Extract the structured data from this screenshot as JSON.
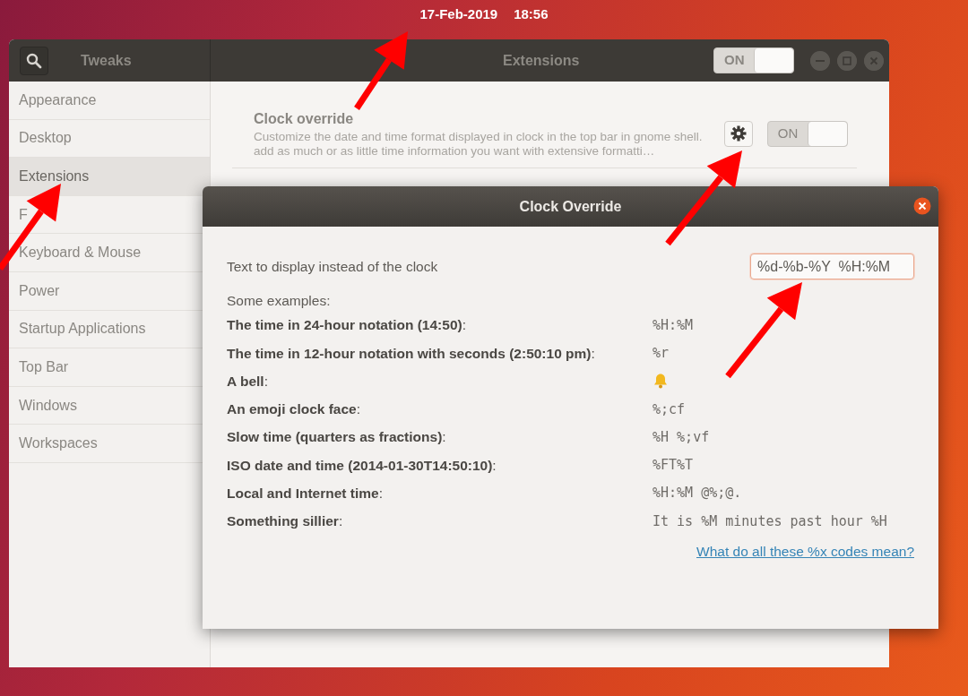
{
  "top_bar": {
    "date": "17-Feb-2019",
    "time": "18:56"
  },
  "tweaks_window": {
    "title": "Tweaks",
    "page_title": "Extensions",
    "global_switch": {
      "label": "ON",
      "on": true
    },
    "sidebar": {
      "items": [
        {
          "label": "Appearance",
          "selected": false
        },
        {
          "label": "Desktop",
          "selected": false
        },
        {
          "label": "Extensions",
          "selected": true
        },
        {
          "label": "F",
          "selected": false
        },
        {
          "label": "Keyboard & Mouse",
          "selected": false
        },
        {
          "label": "Power",
          "selected": false
        },
        {
          "label": "Startup Applications",
          "selected": false
        },
        {
          "label": "Top Bar",
          "selected": false
        },
        {
          "label": "Windows",
          "selected": false
        },
        {
          "label": "Workspaces",
          "selected": false
        }
      ]
    },
    "extensions": [
      {
        "name": "Clock override",
        "description": "Customize the date and time format displayed in clock in the top bar in gnome shell. add as much or as little time information you want with extensive formatti…",
        "switch": {
          "label": "ON",
          "on": true
        }
      }
    ]
  },
  "dialog": {
    "title": "Clock Override",
    "field_label": "Text to display instead of the clock",
    "field_value": "%d-%b-%Y  %H:%M",
    "examples_heading": "Some examples:",
    "examples": [
      {
        "label": "**The time in 24-hour notation (14:50)**:",
        "kind": "code",
        "format": "%H:%M"
      },
      {
        "label": "**The time in 12-hour notation with seconds (2:50:10 pm)**:",
        "kind": "code",
        "format": "%r"
      },
      {
        "label": "**A bell**:",
        "kind": "bell"
      },
      {
        "label": "**An emoji clock face**:",
        "kind": "code",
        "format": "%;cf"
      },
      {
        "label": "**Slow time (quarters as fractions)**:",
        "kind": "code",
        "format": "%H %;vf"
      },
      {
        "label": "**ISO date and time (2014-01-30T14:50:10)**:",
        "kind": "code",
        "format": "%FT%T"
      },
      {
        "label": "**Local and Internet time**:",
        "kind": "code",
        "format": "%H:%M @%;@."
      },
      {
        "label": "**Something sillier**:",
        "kind": "code",
        "format": "It is %M minutes past hour %H"
      }
    ],
    "link": "What do all these %x codes mean?"
  }
}
